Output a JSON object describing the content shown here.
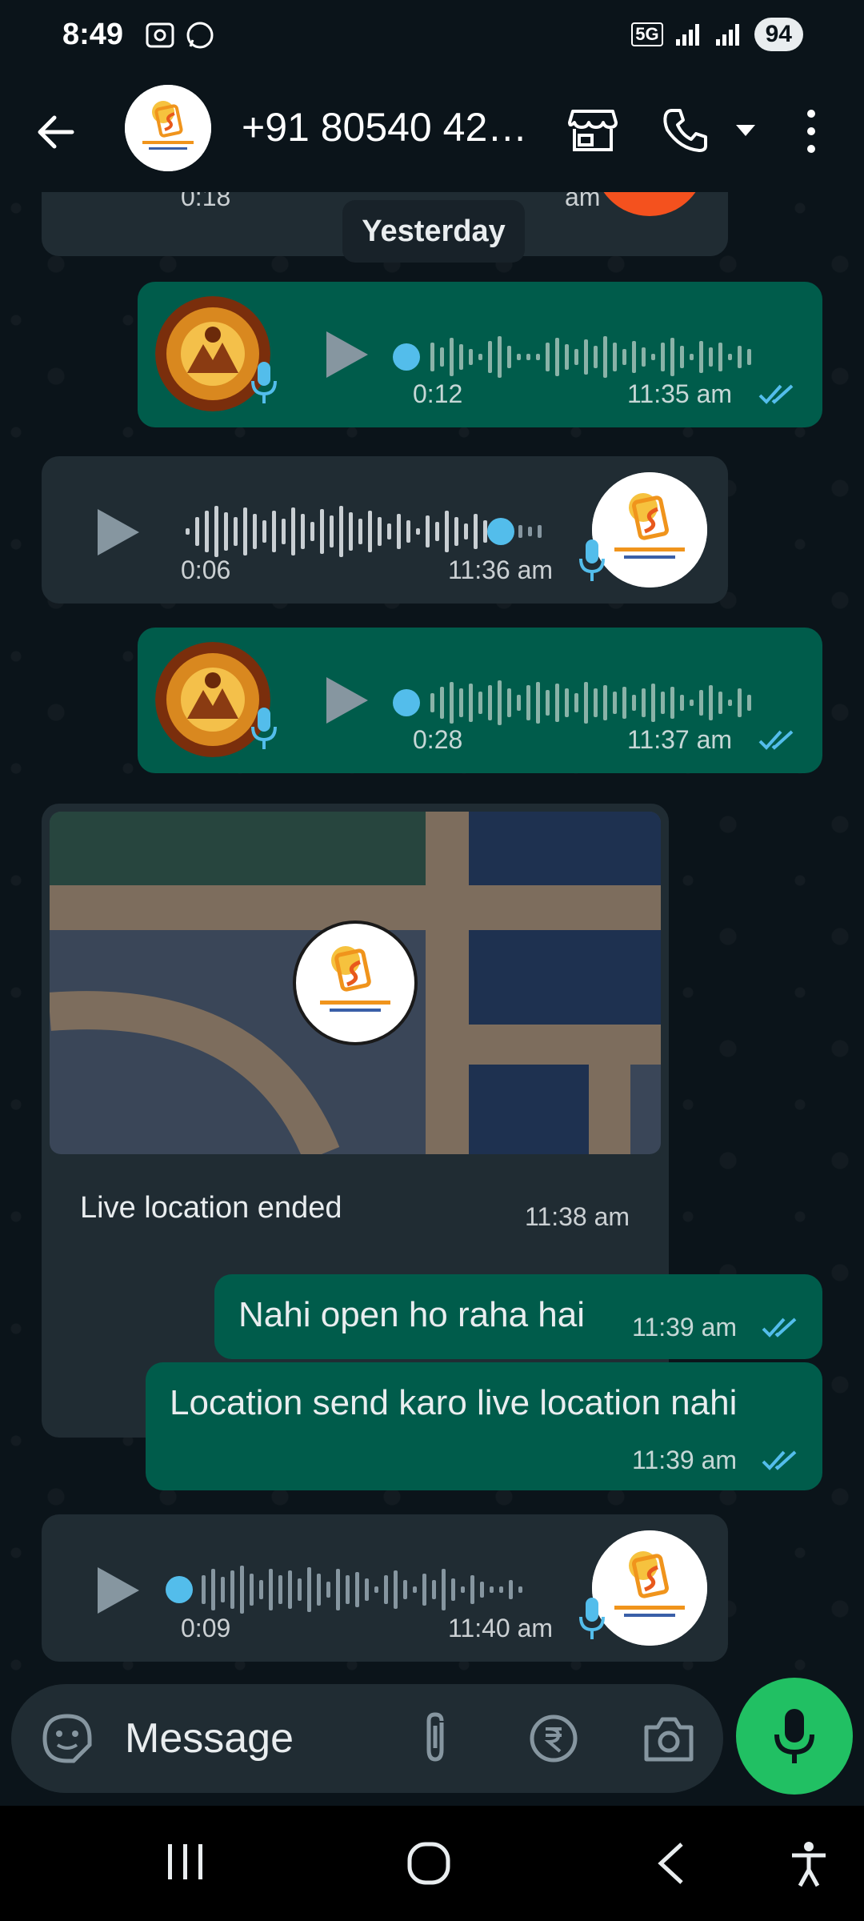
{
  "status_bar": {
    "time": "8:49",
    "battery": "94",
    "network": "5G"
  },
  "header": {
    "contact_name": "+91 80540 42…"
  },
  "chat": {
    "date_separator": "Yesterday",
    "partial_top": {
      "duration": "0:18",
      "time": "am"
    },
    "messages": [
      {
        "type": "voice",
        "direction": "out",
        "duration": "0:12",
        "time": "11:35 am"
      },
      {
        "type": "voice",
        "direction": "in",
        "duration": "0:06",
        "time": "11:36 am"
      },
      {
        "type": "voice",
        "direction": "out",
        "duration": "0:28",
        "time": "11:37 am"
      },
      {
        "type": "live_location",
        "direction": "in",
        "caption": "Live location ended",
        "time": "11:38 am"
      },
      {
        "type": "text",
        "direction": "out",
        "text": "Nahi open ho raha hai",
        "time": "11:39 am"
      },
      {
        "type": "text",
        "direction": "out",
        "text": "Location send karo live location nahi",
        "time": "11:39 am"
      },
      {
        "type": "voice",
        "direction": "in",
        "duration": "0:09",
        "time": "11:40 am"
      }
    ]
  },
  "composer": {
    "placeholder": "Message"
  },
  "colors": {
    "accent_green": "#21c063",
    "outgoing_bubble": "#005c4b",
    "incoming_bubble": "#202c33",
    "read_ticks": "#53bdeb"
  }
}
